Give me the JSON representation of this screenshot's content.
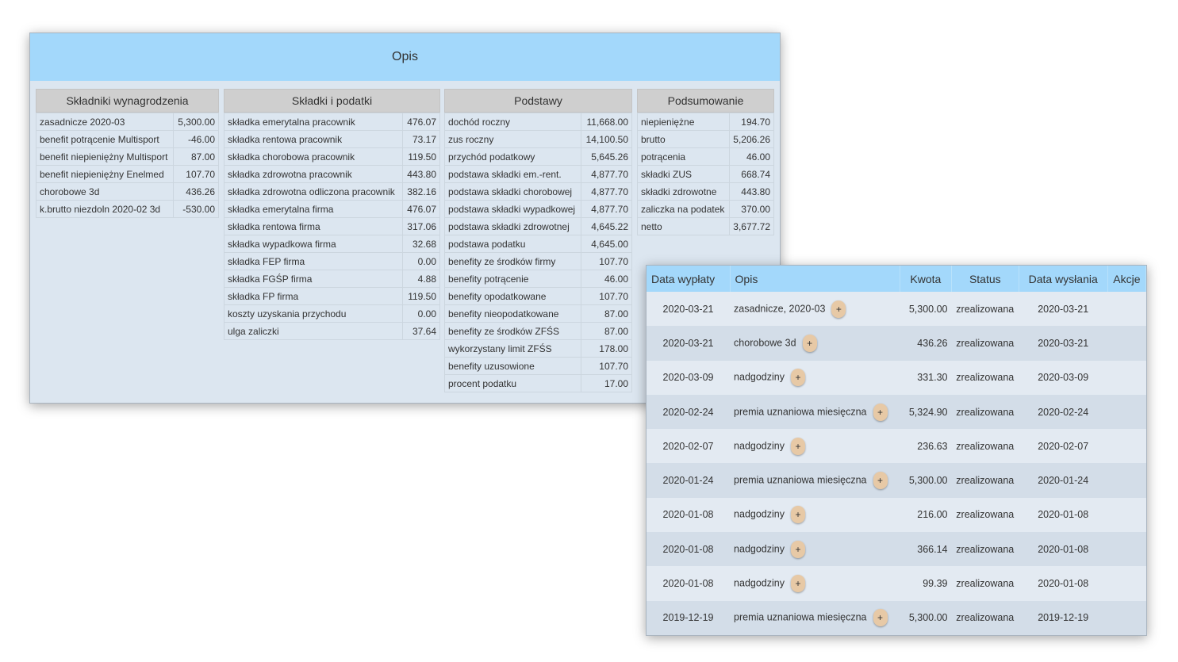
{
  "opis": {
    "title": "Opis",
    "sections": {
      "skladniki": {
        "title": "Składniki wynagrodzenia",
        "rows": [
          {
            "label": "zasadnicze 2020-03",
            "value": "5,300.00"
          },
          {
            "label": "benefit potrącenie Multisport",
            "value": "-46.00"
          },
          {
            "label": "benefit niepieniężny Multisport",
            "value": "87.00"
          },
          {
            "label": "benefit niepieniężny Enelmed",
            "value": "107.70"
          },
          {
            "label": "chorobowe 3d",
            "value": "436.26"
          },
          {
            "label": "k.brutto niezdoln 2020-02 3d",
            "value": "-530.00"
          }
        ]
      },
      "skladki": {
        "title": "Składki i podatki",
        "rows": [
          {
            "label": "składka emerytalna pracownik",
            "value": "476.07"
          },
          {
            "label": "składka rentowa pracownik",
            "value": "73.17"
          },
          {
            "label": "składka chorobowa pracownik",
            "value": "119.50"
          },
          {
            "label": "składka zdrowotna pracownik",
            "value": "443.80"
          },
          {
            "label": "składka zdrowotna odliczona pracownik",
            "value": "382.16"
          },
          {
            "label": "składka emerytalna firma",
            "value": "476.07"
          },
          {
            "label": "składka rentowa firma",
            "value": "317.06"
          },
          {
            "label": "składka wypadkowa firma",
            "value": "32.68"
          },
          {
            "label": "składka FEP firma",
            "value": "0.00"
          },
          {
            "label": "składka FGŚP firma",
            "value": "4.88"
          },
          {
            "label": "składka FP firma",
            "value": "119.50"
          },
          {
            "label": "koszty uzyskania przychodu",
            "value": "0.00"
          },
          {
            "label": "ulga zaliczki",
            "value": "37.64"
          }
        ]
      },
      "podstawy": {
        "title": "Podstawy",
        "rows": [
          {
            "label": "dochód roczny",
            "value": "11,668.00"
          },
          {
            "label": "zus roczny",
            "value": "14,100.50"
          },
          {
            "label": "przychód podatkowy",
            "value": "5,645.26"
          },
          {
            "label": "podstawa składki em.-rent.",
            "value": "4,877.70"
          },
          {
            "label": "podstawa składki chorobowej",
            "value": "4,877.70"
          },
          {
            "label": "podstawa składki wypadkowej",
            "value": "4,877.70"
          },
          {
            "label": "podstawa składki zdrowotnej",
            "value": "4,645.22"
          },
          {
            "label": "podstawa podatku",
            "value": "4,645.00"
          },
          {
            "label": "benefity ze środków firmy",
            "value": "107.70"
          },
          {
            "label": "benefity potrącenie",
            "value": "46.00"
          },
          {
            "label": "benefity opodatkowane",
            "value": "107.70"
          },
          {
            "label": "benefity nieopodatkowane",
            "value": "87.00"
          },
          {
            "label": "benefity ze środków ZFŚS",
            "value": "87.00"
          },
          {
            "label": "wykorzystany limit ZFŚS",
            "value": "178.00"
          },
          {
            "label": "benefity uzusowione",
            "value": "107.70"
          },
          {
            "label": "procent podatku",
            "value": "17.00"
          }
        ]
      },
      "podsumowanie": {
        "title": "Podsumowanie",
        "rows": [
          {
            "label": "niepieniężne",
            "value": "194.70"
          },
          {
            "label": "brutto",
            "value": "5,206.26"
          },
          {
            "label": "potrącenia",
            "value": "46.00"
          },
          {
            "label": "składki ZUS",
            "value": "668.74"
          },
          {
            "label": "składki zdrowotne",
            "value": "443.80"
          },
          {
            "label": "zaliczka na podatek",
            "value": "370.00"
          },
          {
            "label": "netto",
            "value": "3,677.72"
          }
        ]
      }
    }
  },
  "payments": {
    "headers": {
      "data_wyplaty": "Data wypłaty",
      "opis": "Opis",
      "kwota": "Kwota",
      "status": "Status",
      "data_wyslania": "Data wysłania",
      "akcje": "Akcje"
    },
    "expand_label": "+",
    "rows": [
      {
        "date": "2020-03-21",
        "opis": "zasadnicze, 2020-03",
        "kwota": "5,300.00",
        "status": "zrealizowana",
        "sent": "2020-03-21"
      },
      {
        "date": "2020-03-21",
        "opis": "chorobowe 3d",
        "kwota": "436.26",
        "status": "zrealizowana",
        "sent": "2020-03-21"
      },
      {
        "date": "2020-03-09",
        "opis": "nadgodziny",
        "kwota": "331.30",
        "status": "zrealizowana",
        "sent": "2020-03-09"
      },
      {
        "date": "2020-02-24",
        "opis": "premia uznaniowa miesięczna",
        "kwota": "5,324.90",
        "status": "zrealizowana",
        "sent": "2020-02-24"
      },
      {
        "date": "2020-02-07",
        "opis": "nadgodziny",
        "kwota": "236.63",
        "status": "zrealizowana",
        "sent": "2020-02-07"
      },
      {
        "date": "2020-01-24",
        "opis": "premia uznaniowa miesięczna",
        "kwota": "5,300.00",
        "status": "zrealizowana",
        "sent": "2020-01-24"
      },
      {
        "date": "2020-01-08",
        "opis": "nadgodziny",
        "kwota": "216.00",
        "status": "zrealizowana",
        "sent": "2020-01-08"
      },
      {
        "date": "2020-01-08",
        "opis": "nadgodziny",
        "kwota": "366.14",
        "status": "zrealizowana",
        "sent": "2020-01-08"
      },
      {
        "date": "2020-01-08",
        "opis": "nadgodziny",
        "kwota": "99.39",
        "status": "zrealizowana",
        "sent": "2020-01-08"
      },
      {
        "date": "2019-12-19",
        "opis": "premia uznaniowa miesięczna",
        "kwota": "5,300.00",
        "status": "zrealizowana",
        "sent": "2019-12-19"
      }
    ]
  }
}
